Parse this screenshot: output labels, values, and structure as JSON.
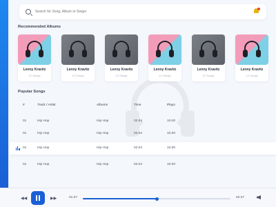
{
  "search": {
    "placeholder": "Search for Song, Album or Singer"
  },
  "sections": {
    "recommended": "Recommended Albums",
    "popular": "Popular Songs"
  },
  "albums": [
    {
      "artist": "Lenny Kravitz",
      "count": "12 Songs",
      "cover": "color"
    },
    {
      "artist": "Lenny Kravitz",
      "count": "12 Songs",
      "cover": "gray"
    },
    {
      "artist": "Lenny Kravitz",
      "count": "12 Songs",
      "cover": "gray"
    },
    {
      "artist": "Lenny Kravitz",
      "count": "12 Songs",
      "cover": "color"
    },
    {
      "artist": "Lenny Kravitz",
      "count": "12 Songs",
      "cover": "gray"
    },
    {
      "artist": "Lenny Kravitz",
      "count": "12 Songs",
      "cover": "color"
    }
  ],
  "table": {
    "headers": {
      "num": "#",
      "track": "Track / Artist",
      "album": "Albums",
      "time": "Time",
      "plays": "Plays"
    },
    "rows": [
      {
        "num": "01",
        "track": "Hip Hop",
        "album": "Hip Hop",
        "time": "02.04",
        "plays": "10.00"
      },
      {
        "num": "01",
        "track": "Hip Hop",
        "album": "Hip Hop",
        "time": "02.04",
        "plays": "10.00"
      },
      {
        "num": "01",
        "track": "Hip Hop",
        "album": "Hip Hop",
        "time": "02.04",
        "plays": "10.00"
      },
      {
        "num": "01",
        "track": "Hip Hop",
        "album": "Hip Hop",
        "time": "02.04",
        "plays": "10.00"
      }
    ],
    "active_row": 2
  },
  "player": {
    "current_time": "01:37",
    "total_time": "02:37",
    "progress": 0.5,
    "state": "playing"
  },
  "colors": {
    "accent": "#1a5fd6",
    "bell": "#e9b20c",
    "notification": "#e8453c"
  },
  "icons": {
    "search": "search-icon",
    "bell": "bell-icon",
    "prev": "previous-icon",
    "pause": "pause-icon",
    "next": "next-icon",
    "volume": "volume-icon",
    "equalizer": "equalizer-icon"
  }
}
